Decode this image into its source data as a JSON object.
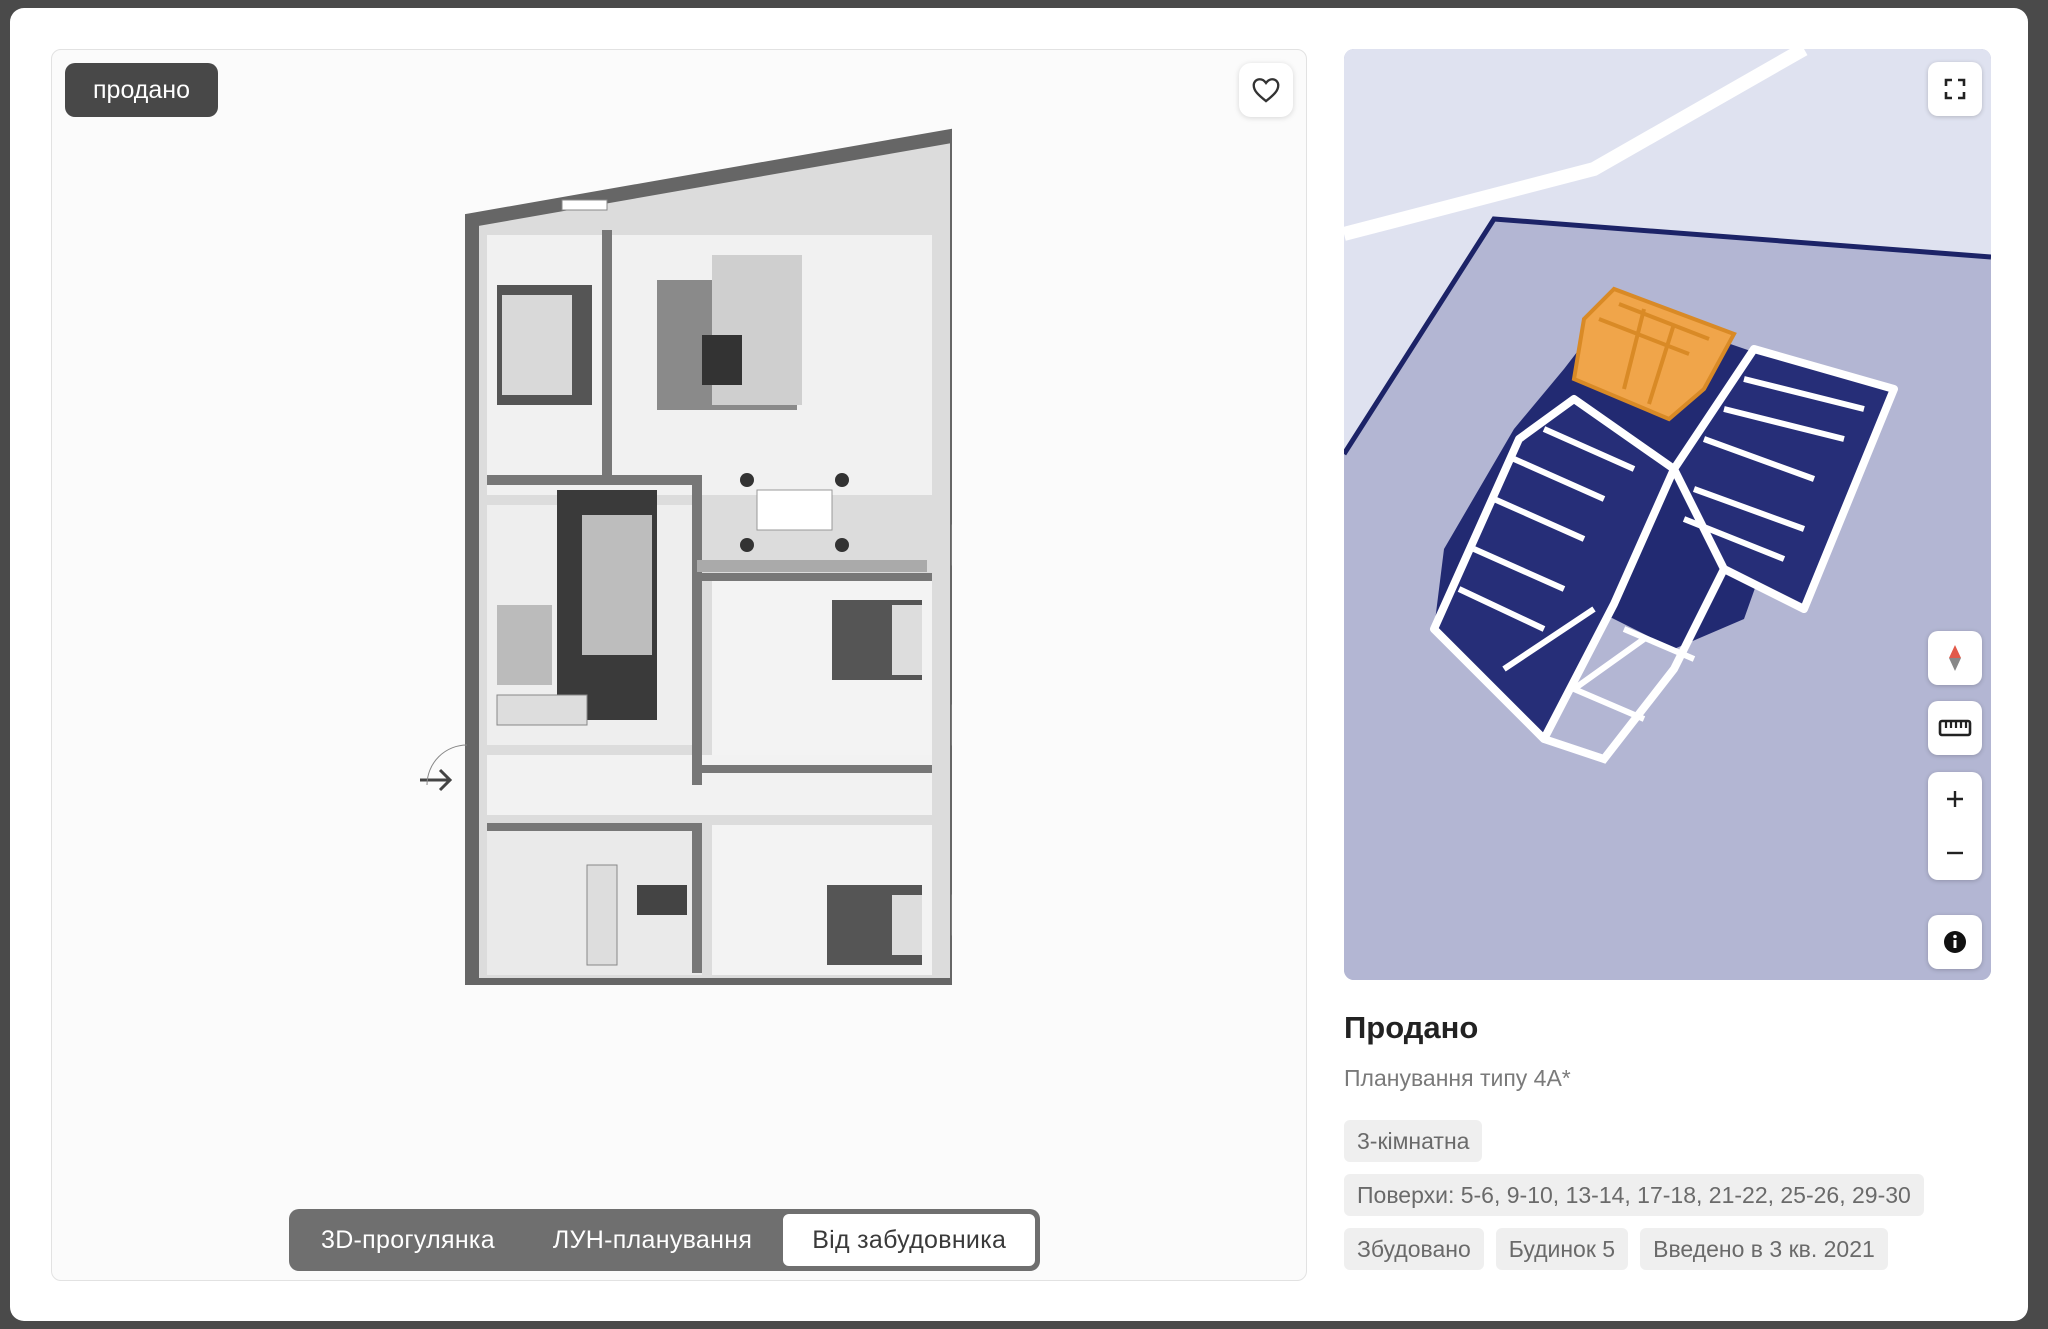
{
  "status_badge": "продано",
  "tabs": [
    {
      "label": "3D-прогулянка",
      "active": false
    },
    {
      "label": "ЛУН-планування",
      "active": false
    },
    {
      "label": "Від забудовника",
      "active": true
    }
  ],
  "info": {
    "title": "Продано",
    "subtitle": "Планування типу 4А*",
    "chips_row1": [
      "3-кімнатна"
    ],
    "chips_row2": [
      "Поверхи: 5-6, 9-10, 13-14, 17-18, 21-22, 25-26, 29-30"
    ],
    "chips_row3": [
      "Збудовано",
      "Будинок 5",
      "Введено в 3 кв. 2021"
    ]
  },
  "icons": {
    "favorite": "heart-icon",
    "fullscreen": "fullscreen-icon",
    "compass": "compass-icon",
    "ruler": "ruler-icon",
    "zoom_in": "plus-icon",
    "zoom_out": "minus-icon",
    "info": "info-icon"
  },
  "colors": {
    "badge_bg": "#484848",
    "map_ground": "#b3b6d3",
    "map_building": "#222a72",
    "map_highlight": "#f0a54a"
  }
}
